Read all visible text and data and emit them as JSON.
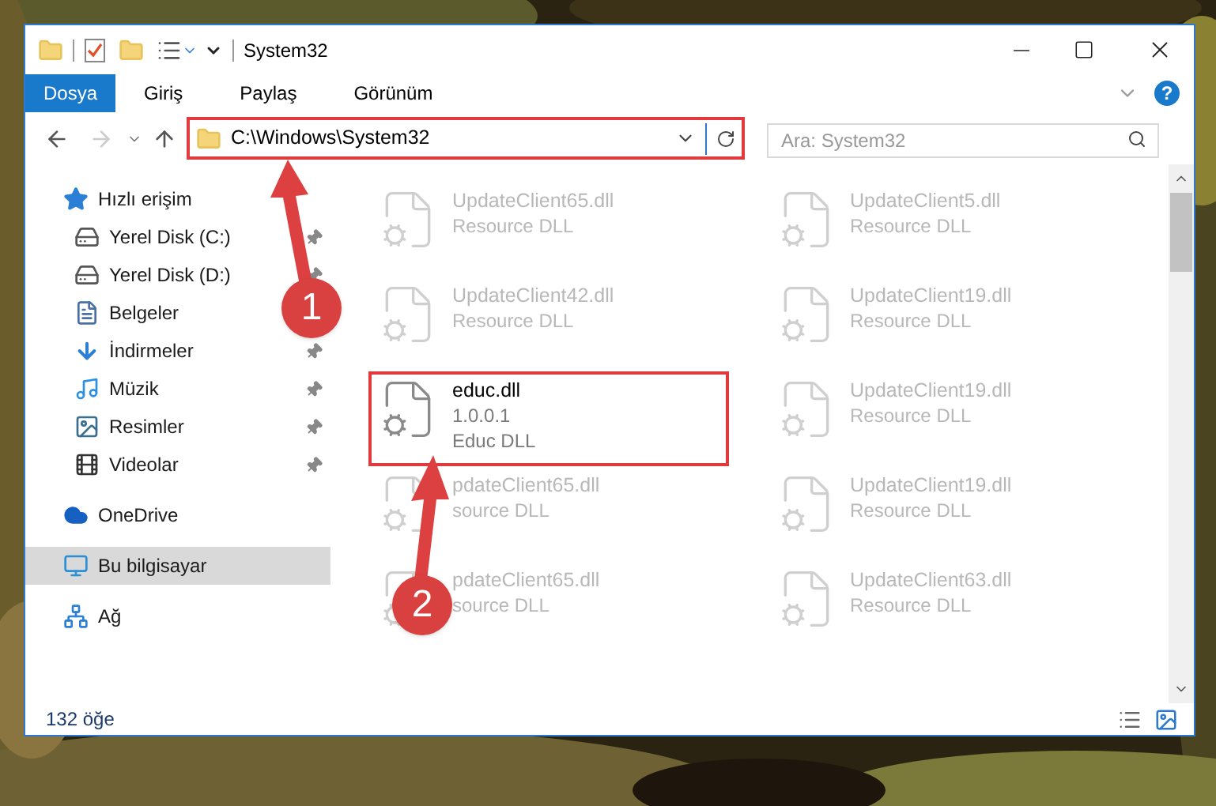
{
  "window": {
    "title": "System32"
  },
  "ribbon": {
    "tabs": [
      {
        "label": "Dosya",
        "selected": true
      },
      {
        "label": "Giriş",
        "selected": false
      },
      {
        "label": "Paylaş",
        "selected": false
      },
      {
        "label": "Görünüm",
        "selected": false
      }
    ],
    "help": "?"
  },
  "address": {
    "path": "C:\\Windows\\System32",
    "annotated": true
  },
  "search": {
    "placeholder": "Ara: System32"
  },
  "sidebar": {
    "items": [
      {
        "label": "Hızlı erişim",
        "selected": false,
        "children": [
          {
            "label": "Yerel Disk (C:)",
            "pinned": true
          },
          {
            "label": "Yerel Disk (D:)",
            "pinned": true
          },
          {
            "label": "Belgeler"
          },
          {
            "label": "İndirmeler",
            "pinned": true
          },
          {
            "label": "Müzik",
            "pinned": true
          },
          {
            "label": "Resimler",
            "pinned": true
          },
          {
            "label": "Videolar",
            "pinned": true
          }
        ]
      },
      {
        "label": "OneDrive",
        "selected": false
      },
      {
        "label": "Bu bilgisayar",
        "selected": true
      },
      {
        "label": "Ağ",
        "selected": false
      }
    ]
  },
  "files": [
    {
      "name": "UpdateClient65.dll",
      "details": [
        "Resource DLL"
      ],
      "blurred": true,
      "annotated": false
    },
    {
      "name": "UpdateClient5.dll",
      "details": [
        "Resource DLL"
      ],
      "blurred": true,
      "annotated": false
    },
    {
      "name": "UpdateClient42.dll",
      "details": [
        "Resource DLL"
      ],
      "blurred": true,
      "annotated": false
    },
    {
      "name": "UpdateClient19.dll",
      "details": [
        "Resource DLL"
      ],
      "blurred": true,
      "annotated": false
    },
    {
      "name": "educ.dll",
      "details": [
        "1.0.0.1",
        "Educ DLL"
      ],
      "blurred": false,
      "annotated": true
    },
    {
      "name": "UpdateClient19.dll",
      "details": [
        "Resource DLL"
      ],
      "blurred": true,
      "annotated": false
    },
    {
      "name": "pdateClient65.dll",
      "details": [
        "source DLL"
      ],
      "blurred": true,
      "annotated": false
    },
    {
      "name": "UpdateClient19.dll",
      "details": [
        "Resource DLL"
      ],
      "blurred": true,
      "annotated": false
    },
    {
      "name": "pdateClient65.dll",
      "details": [
        "source DLL"
      ],
      "blurred": true,
      "annotated": false
    },
    {
      "name": "UpdateClient63.dll",
      "details": [
        "Resource DLL"
      ],
      "blurred": true,
      "annotated": false
    }
  ],
  "status_bar": {
    "count": "132 öğe"
  },
  "annotations": [
    {
      "number": "1"
    },
    {
      "number": "2"
    }
  ]
}
